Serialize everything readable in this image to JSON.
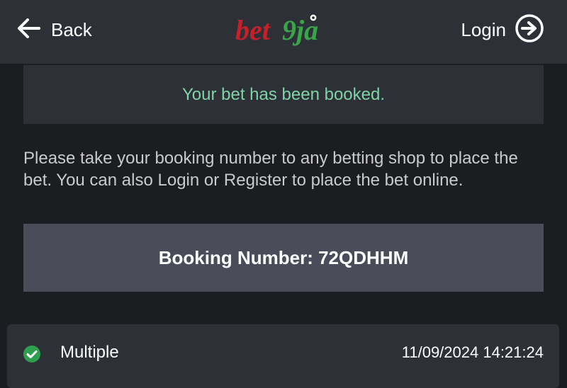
{
  "header": {
    "back_label": "Back",
    "logo_text": "bet9ja",
    "login_label": "Login"
  },
  "confirmation": {
    "message": "Your bet has been booked."
  },
  "instructions": "Please take your booking number to any betting shop to place the bet. You can also Login or Register to place the bet online.",
  "booking": {
    "label": "Booking Number: 72QDHHM"
  },
  "bet": {
    "type": "Multiple",
    "datetime": "11/09/2024 14:21:24",
    "status_icon": "check-circle-icon"
  },
  "colors": {
    "header_bg": "#2e3038",
    "page_bg": "#1c1d21",
    "success_green": "#7fd3a4",
    "booking_bg": "#4a4d59",
    "logo_red": "#c8202a",
    "logo_green": "#3aa548"
  }
}
